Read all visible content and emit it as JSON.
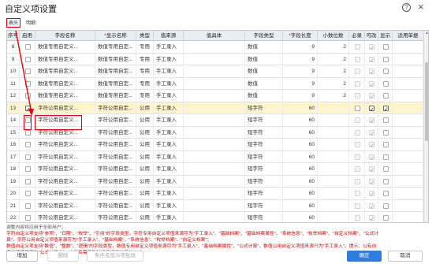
{
  "window": {
    "title": "自定义项设置"
  },
  "tabs": [
    {
      "label": "表头"
    },
    {
      "label": "明细"
    }
  ],
  "columns": {
    "seq": "序号",
    "enable": "启用",
    "field_name": "字段名称",
    "display_name": "显示名称",
    "type": "类型",
    "value_source": "值来源",
    "value_detail": "值具体",
    "field_type": "字段类型",
    "field_length": "字段长度",
    "decimals": "小数位数",
    "required": "必录",
    "editable": "可改",
    "show": "显示",
    "apply_doc": "适用单据"
  },
  "rows": [
    {
      "seq": "8",
      "enabled": false,
      "field_name": "数值专用自定义...",
      "display_name": "数值专用自定...",
      "type": "专用",
      "source": "手工录入",
      "field_type": "数值",
      "length": "9",
      "decimals": "2",
      "required": false,
      "editable": true,
      "show": false,
      "selected": false
    },
    {
      "seq": "9",
      "enabled": false,
      "field_name": "数值专用自定义...",
      "display_name": "数值专用自定...",
      "type": "专用",
      "source": "手工录入",
      "field_type": "数值",
      "length": "9",
      "decimals": "2",
      "required": false,
      "editable": true,
      "show": false,
      "selected": false
    },
    {
      "seq": "10",
      "enabled": false,
      "field_name": "数值专用自定义...",
      "display_name": "数值专用自定...",
      "type": "专用",
      "source": "手工录入",
      "field_type": "数值",
      "length": "9",
      "decimals": "2",
      "required": false,
      "editable": true,
      "show": false,
      "selected": false
    },
    {
      "seq": "11",
      "enabled": false,
      "field_name": "数值专用自定义...",
      "display_name": "数值专用自定...",
      "type": "专用",
      "source": "手工录入",
      "field_type": "数值",
      "length": "9",
      "decimals": "2",
      "required": false,
      "editable": true,
      "show": false,
      "selected": false
    },
    {
      "seq": "12",
      "enabled": false,
      "field_name": "数值专用自定义...",
      "display_name": "数值专用自定...",
      "type": "专用",
      "source": "手工录入",
      "field_type": "数值",
      "length": "9",
      "decimals": "2",
      "required": false,
      "editable": true,
      "show": false,
      "selected": false
    },
    {
      "seq": "13",
      "enabled": true,
      "field_name": "字符公用自定义...",
      "display_name": "字符公用自定...",
      "type": "公用",
      "source": "手工录入",
      "field_type": "短字符",
      "length": "60",
      "decimals": "",
      "required": false,
      "editable": true,
      "show": true,
      "selected": true
    },
    {
      "seq": "14",
      "enabled": false,
      "field_name": "字符公用自定义...",
      "display_name": "字符公用自定...",
      "type": "公用",
      "source": "手工录入",
      "field_type": "短字符",
      "length": "60",
      "decimals": "",
      "required": false,
      "editable": true,
      "show": false,
      "selected": false
    },
    {
      "seq": "15",
      "enabled": false,
      "field_name": "字符公用自定义...",
      "display_name": "字符公用自定...",
      "type": "公用",
      "source": "手工录入",
      "field_type": "短字符",
      "length": "60",
      "decimals": "",
      "required": false,
      "editable": true,
      "show": false,
      "selected": false
    },
    {
      "seq": "16",
      "enabled": false,
      "field_name": "字符公用自定义...",
      "display_name": "字符公用自定...",
      "type": "公用",
      "source": "手工录入",
      "field_type": "短字符",
      "length": "60",
      "decimals": "",
      "required": false,
      "editable": true,
      "show": false,
      "selected": false
    },
    {
      "seq": "17",
      "enabled": false,
      "field_name": "字符公用自定义...",
      "display_name": "字符公用自定...",
      "type": "公用",
      "source": "手工录入",
      "field_type": "短字符",
      "length": "60",
      "decimals": "",
      "required": false,
      "editable": true,
      "show": false,
      "selected": false
    },
    {
      "seq": "18",
      "enabled": false,
      "field_name": "字符公用自定义...",
      "display_name": "字符公用自定...",
      "type": "公用",
      "source": "手工录入",
      "field_type": "短字符",
      "length": "60",
      "decimals": "",
      "required": false,
      "editable": true,
      "show": false,
      "selected": false
    },
    {
      "seq": "19",
      "enabled": false,
      "field_name": "字符公用自定义...",
      "display_name": "字符公用自定...",
      "type": "公用",
      "source": "手工录入",
      "field_type": "短字符",
      "length": "60",
      "decimals": "",
      "required": false,
      "editable": true,
      "show": false,
      "selected": false
    },
    {
      "seq": "20",
      "enabled": false,
      "field_name": "字符公用自定义...",
      "display_name": "字符公用自定...",
      "type": "公用",
      "source": "手工录入",
      "field_type": "短字符",
      "length": "60",
      "decimals": "",
      "required": false,
      "editable": true,
      "show": false,
      "selected": false
    },
    {
      "seq": "21",
      "enabled": false,
      "field_name": "字符公用自定义...",
      "display_name": "字符公用自定...",
      "type": "公用",
      "source": "手工录入",
      "field_type": "短字符",
      "length": "60",
      "decimals": "",
      "required": false,
      "editable": true,
      "show": false,
      "selected": false
    },
    {
      "seq": "22",
      "enabled": false,
      "field_name": "字符公用自定义...",
      "display_name": "字符公用自定...",
      "type": "公用",
      "source": "手工录入",
      "field_type": "短字符",
      "length": "60",
      "decimals": "",
      "required": false,
      "editable": true,
      "show": false,
      "selected": false
    }
  ],
  "notes": {
    "line1": "调整内容将应用于全部用户；",
    "line2": "字符自定义项支持\"参照\"、\"日期\"、\"枚举\"、\"引用\"的字段类型，字符专用自定义项值来源可为\"手工录入\"、\"基础档案\"、\"基础档案属性\"、\"系统信息\"、\"枚举档案\"、\"自定义档案\"、\"公式计",
    "line3": "算\"，字符公用自定义项值来源可为\"手工录入\"、\"基础档案\"、\"系统信息\"、\"枚举档案\"、\"自定义档案\"；",
    "line4": "数值自定义项支持\"数值\"、\"整数\"、\"逻辑\"的字段类型，数值专用自定义项值来源可为\"手工录入\"、\"基础档案属性\"、\"公式计算\"，数值公用自定义项值来源只为\"手工录入\"。提示：公有自",
    "line5": "定义项值来源为\"公式计算\"时，启用后需要及时设置适用单据的公式。"
  },
  "footer": {
    "add": "增加",
    "delete": "删除",
    "conditional_show": "条件及显示项批改",
    "ok": "确定",
    "cancel": "取消"
  },
  "colors": {
    "accent": "#2d7ee0",
    "highlight": "#e00000",
    "selected_row": "#fff5cc"
  }
}
